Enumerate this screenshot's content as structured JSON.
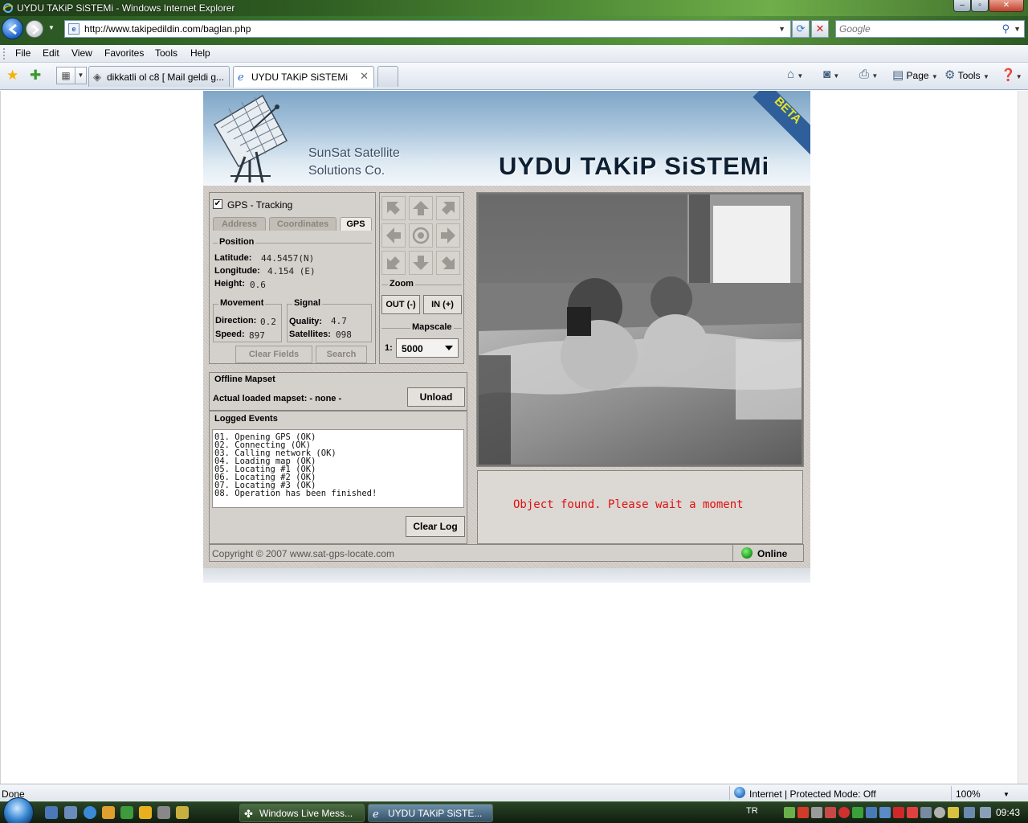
{
  "window": {
    "title": "UYDU TAKiP SiSTEMi - Windows Internet Explorer",
    "minimize_glyph": "–",
    "maximize_glyph": "▫",
    "close_glyph": "✕"
  },
  "address_bar": {
    "url": "http://www.takipedildin.com/baglan.php",
    "refresh_glyph": "⟳",
    "stop_glyph": "✕"
  },
  "search": {
    "placeholder": "Google"
  },
  "menu": [
    "File",
    "Edit",
    "View",
    "Favorites",
    "Tools",
    "Help"
  ],
  "tabs": [
    {
      "label": "dikkatli ol c8 [ Mail geldi g...",
      "active": false,
      "icon": "page-icon"
    },
    {
      "label": "UYDU TAKiP SiSTEMi",
      "active": true,
      "icon": "ie-page-icon"
    }
  ],
  "toolbar": {
    "page_label": "Page",
    "tools_label": "Tools"
  },
  "banner": {
    "company_line1": "SunSat Satellite",
    "company_line2": "Solutions Co.",
    "site_title": "UYDU TAKiP SiSTEMi",
    "ribbon": "BETA"
  },
  "gps_panel": {
    "title": "GPS - Tracking",
    "checked": true,
    "tabs": [
      "Address",
      "Coordinates",
      "GPS"
    ],
    "position": {
      "legend": "Position",
      "latitude_label": "Latitude:",
      "latitude_value": "44.5457(N)",
      "longitude_label": "Longitude:",
      "longitude_value": "4.154 (E)",
      "height_label": "Height:",
      "height_value": "0.6"
    },
    "movement": {
      "legend": "Movement",
      "direction_label": "Direction:",
      "direction_value": "0.2",
      "speed_label": "Speed:",
      "speed_value": "897"
    },
    "signal": {
      "legend": "Signal",
      "quality_label": "Quality:",
      "quality_value": "4.7",
      "satellites_label": "Satellites:",
      "satellites_value": "098"
    },
    "clear_fields_label": "Clear Fields",
    "search_label": "Search"
  },
  "navigation": {
    "zoom_legend": "Zoom",
    "zoom_out_label": "OUT (-)",
    "zoom_in_label": "IN (+)",
    "mapscale_legend": "Mapscale",
    "scale_prefix": "1:",
    "scale_value": "5000"
  },
  "mapset": {
    "title": "Offline Mapset",
    "loaded_label": "Actual loaded mapset: - none -",
    "unload_label": "Unload"
  },
  "log": {
    "title": "Logged Events",
    "entries": [
      "01. Opening GPS (OK)",
      "02. Connecting (OK)",
      "03. Calling network (OK)",
      "04. Loading map (OK)",
      "05. Locating #1 (OK)",
      "06. Locating #2 (OK)",
      "07. Locating #3 (OK)",
      "08. Operation has been finished!"
    ],
    "clear_label": "Clear Log"
  },
  "status_message": "Object found. Please wait a moment",
  "footer": {
    "copyright": "Copyright © 2007 www.sat-gps-locate.com",
    "online_label": "Online"
  },
  "statusbar": {
    "status": "Done",
    "zone": "Internet | Protected Mode: Off",
    "zoom": "100%"
  },
  "taskbar": {
    "buttons": [
      {
        "label": "Windows Live Mess...",
        "icon": "messenger-icon"
      },
      {
        "label": "UYDU TAKiP SiSTE...",
        "icon": "ie-icon"
      }
    ],
    "language": "TR",
    "clock": "09:43"
  },
  "colors": {
    "alert_text": "#e01010",
    "online_green": "#1a9a1a",
    "panel_gray": "#d4d0cc"
  }
}
